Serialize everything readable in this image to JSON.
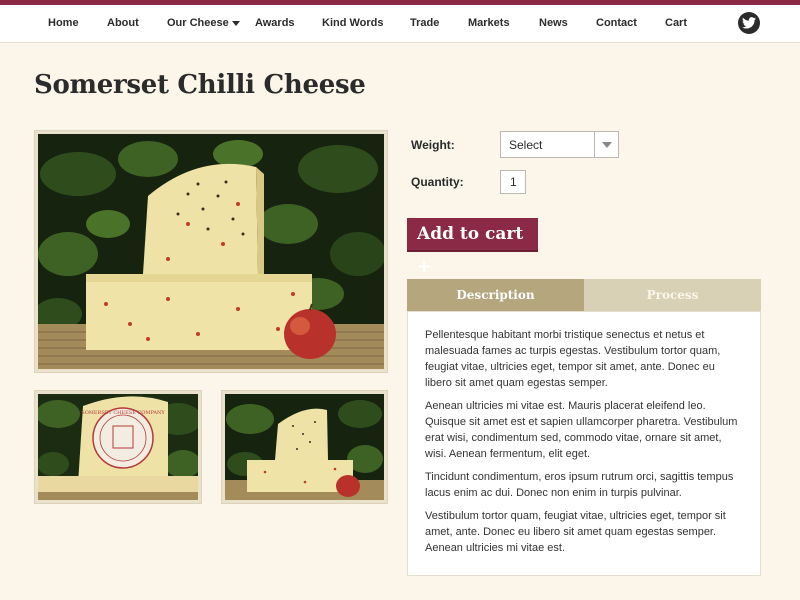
{
  "nav": {
    "items": [
      {
        "label": "Home"
      },
      {
        "label": "About"
      },
      {
        "label": "Our Cheese",
        "has_dropdown": true
      },
      {
        "label": "Awards"
      },
      {
        "label": "Kind Words"
      },
      {
        "label": "Trade"
      },
      {
        "label": "Markets"
      },
      {
        "label": "News"
      },
      {
        "label": "Contact"
      },
      {
        "label": "Cart"
      }
    ],
    "social_icon": "twitter-icon"
  },
  "product": {
    "title": "Somerset Chilli Cheese",
    "weight_label": "Weight:",
    "weight_value": "Select",
    "quantity_label": "Quantity:",
    "quantity_value": "1",
    "add_to_cart_label": "Add to cart +"
  },
  "tabs": {
    "description_label": "Description",
    "process_label": "Process",
    "active": "Description"
  },
  "description": {
    "paragraphs": [
      "Pellentesque habitant morbi tristique senectus et netus et malesuada fames ac turpis egestas. Vestibulum tortor quam, feugiat vitae, ultricies eget, tempor sit amet, ante. Donec eu libero sit amet quam egestas semper.",
      "Aenean ultricies mi vitae est. Mauris placerat eleifend leo. Quisque sit amet est et sapien ullamcorper pharetra. Vestibulum erat wisi, condimentum sed, commodo vitae, ornare sit amet, wisi. Aenean fermentum, elit eget.",
      "Tincidunt condimentum, eros ipsum rutrum orci, sagittis tempus lacus enim ac dui. Donec non enim in turpis pulvinar.",
      "Vestibulum tortor quam, feugiat vitae, ultricies eget, tempor sit amet, ante. Donec eu libero sit amet quam egestas semper. Aenean ultricies mi vitae est."
    ]
  },
  "thumbnails": {
    "label_text": "SOMERSET CHEESE COMPANY"
  },
  "colors": {
    "brand": "#8a2a46",
    "background": "#fbf6e9",
    "tab_active": "#b5a67e",
    "tab_inactive": "#d9d1b6"
  }
}
